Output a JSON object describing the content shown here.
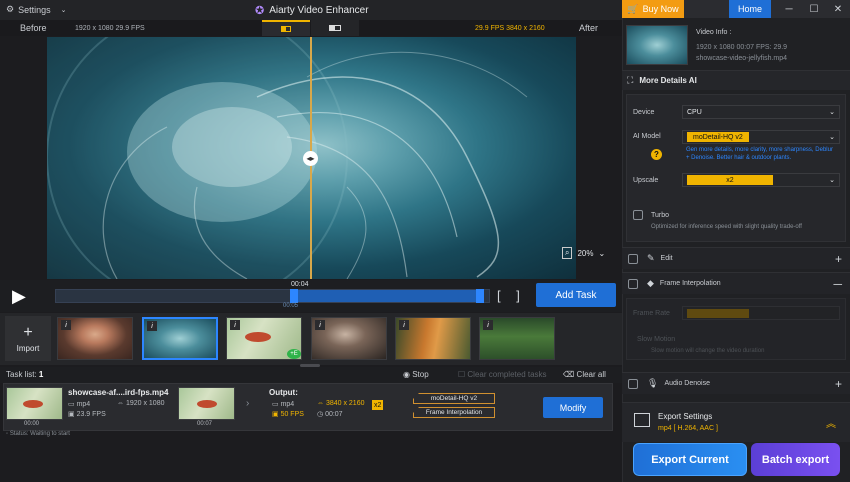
{
  "titlebar": {
    "settings_label": "Settings",
    "app_title": "Aiarty Video Enhancer",
    "buy_now": "Buy Now",
    "home": "Home"
  },
  "compare": {
    "before": "Before",
    "after": "After",
    "source_info": "1920 x 1080  29.9 FPS",
    "output_info": "29.9 FPS  3840 x 2160"
  },
  "player": {
    "zoom": "20%",
    "time_top": "00:04",
    "time_bottom": "00:05",
    "add_task": "Add Task"
  },
  "thumbs": {
    "import_label": "Import",
    "badge": "i",
    "e_badge": "+E"
  },
  "tasklist": {
    "label": "Task list:",
    "count": "1",
    "stop": "Stop",
    "clear_completed": "Clear completed tasks",
    "clear_all": "Clear all"
  },
  "task": {
    "filename": "showcase-af....ird-fps.mp4",
    "format": "mp4",
    "resolution": "1920 x 1080",
    "fps": "23.9 FPS",
    "time_in": "00:00",
    "time_out": "00:07",
    "output_label": "Output:",
    "out_format": "mp4",
    "out_resolution": "3840 x 2160",
    "out_fps": "50 FPS",
    "out_time": "00:07",
    "scale_badge": "x2",
    "model_tag": "moDetail-HQ  v2",
    "interp_tag": "Frame Interpolation",
    "modify": "Modify",
    "status": "Status: Waiting to start"
  },
  "panel": {
    "video_info_title": "Video Info :",
    "video_info_line1": "1920 x 1080   00:07     FPS: 29.9",
    "video_info_line2": "showcase-video-jellyfish.mp4",
    "ai_title": "More Details AI",
    "device_label": "Device",
    "device_value": "CPU",
    "ai_model_label": "AI Model",
    "ai_model_value": "moDetail-HQ  v2",
    "ai_model_desc": "Gen more details, more clarity, more sharpness, Deblur + Denoise. Better hair & outdoor plants.",
    "upscale_label": "Upscale",
    "upscale_value": "x2",
    "turbo_label": "Turbo",
    "turbo_desc": "Optimized for inference speed with slight quality trade-off",
    "edit_label": "Edit",
    "frame_interp_label": "Frame Interpolation",
    "frame_rate_label": "Frame Rate",
    "slow_motion_label": "Slow Motion",
    "slow_motion_desc": "Slow motion will change the video duration",
    "audio_label": "Audio Denoise",
    "export_settings_label": "Export Settings",
    "export_settings_value": "mp4 [ H.264, AAC ]",
    "export_current": "Export Current",
    "batch_export": "Batch export"
  },
  "colors": {
    "accent_blue": "#1f6fd6",
    "accent_orange": "#f39c12",
    "accent_yellow": "#f0b400",
    "batch_purple": "#6a48e6"
  }
}
